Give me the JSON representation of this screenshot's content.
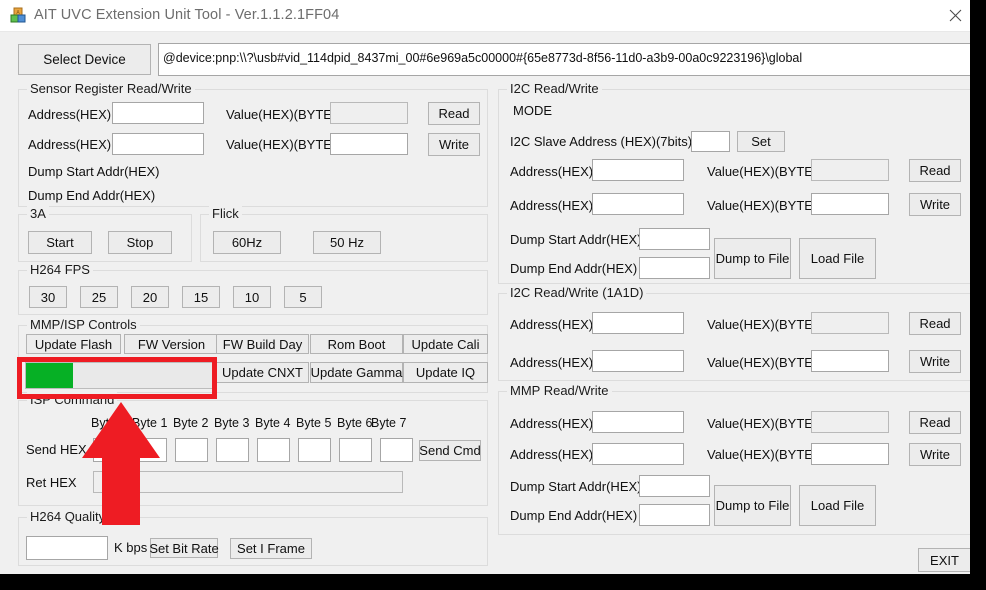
{
  "window": {
    "title": "AIT UVC Extension Unit Tool - Ver.1.1.2.1FF04",
    "icon": "blocks-icon",
    "close_icon": "close-icon",
    "accent_green": "#06b025",
    "annotation_red": "#ee1c23"
  },
  "device": {
    "select_button": "Select Device",
    "path_value": "@device:pnp:\\\\?\\usb#vid_114dpid_8437mi_00#6e969a5c00000#{65e8773d-8f56-11d0-a3b9-00a0c9223196}\\global",
    "path_placeholder": ""
  },
  "sensor": {
    "title": "Sensor Register Read/Write",
    "addr_label_1": "Address(HEX)",
    "addr_value_1": "",
    "value_label_1": "Value(HEX)(BYTE)",
    "value_value_1": "",
    "read_button": "Read",
    "addr_label_2": "Address(HEX)",
    "addr_value_2": "",
    "value_label_2": "Value(HEX)(BYTE)",
    "value_value_2": "",
    "write_button": "Write",
    "dump_start_label": "Dump Start Addr(HEX)",
    "dump_end_label": "Dump End Addr(HEX)"
  },
  "threea": {
    "title": "3A",
    "start_button": "Start",
    "stop_button": "Stop"
  },
  "flick": {
    "title": "Flick",
    "hz60_button": "60Hz",
    "hz50_button": "50 Hz"
  },
  "h264fps": {
    "title": "H264 FPS",
    "options": [
      "30",
      "25",
      "20",
      "15",
      "10",
      "5"
    ]
  },
  "mmpisp": {
    "title": "MMP/ISP Controls",
    "row1": [
      "Update Flash",
      "FW Version",
      "FW Build Day",
      "Rom Boot",
      "Update Cali"
    ],
    "row2": [
      "Update CNXT",
      "Update Gamma",
      "Update IQ"
    ],
    "progress_percent": 25
  },
  "isp_command": {
    "title": "ISP Command",
    "byte_headers": [
      "Byte 0",
      "Byte 1",
      "Byte 2",
      "Byte 3",
      "Byte 4",
      "Byte 5",
      "Byte 6",
      "Byte 7"
    ],
    "send_label": "Send  HEX",
    "send_values": [
      "",
      "",
      "",
      "",
      "",
      "",
      "",
      ""
    ],
    "send_button": "Send Cmd",
    "ret_label": "Ret  HEX",
    "ret_value": ""
  },
  "h264quality": {
    "title": "H264 Quality",
    "bitrate_value": "",
    "unit_label": "K bps",
    "set_bit_rate_button": "Set Bit Rate",
    "set_i_frame_button": "Set I Frame"
  },
  "i2c": {
    "title": "I2C Read/Write",
    "mode_label": "MODE",
    "slave_label": "I2C Slave Address (HEX)(7bits)",
    "slave_value": "",
    "set_button": "Set",
    "addr_label_1": "Address(HEX)",
    "addr_value_1": "",
    "value_label_1": "Value(HEX)(BYTE)",
    "value_value_1": "",
    "read_button": "Read",
    "addr_label_2": "Address(HEX)",
    "addr_value_2": "",
    "value_label_2": "Value(HEX)(BYTE)",
    "value_value_2": "",
    "write_button": "Write",
    "dump_start_label": "Dump Start Addr(HEX)",
    "dump_start_value": "",
    "dump_end_label": "Dump End Addr(HEX)",
    "dump_end_value": "",
    "dump_to_file_button": "Dump to File",
    "load_file_button": "Load File"
  },
  "i2c_1a1d": {
    "title": "I2C Read/Write (1A1D)",
    "addr_label_1": "Address(HEX)",
    "addr_value_1": "",
    "value_label_1": "Value(HEX)(BYTE)",
    "value_value_1": "",
    "read_button": "Read",
    "addr_label_2": "Address(HEX)",
    "addr_value_2": "",
    "value_label_2": "Value(HEX)(BYTE)",
    "value_value_2": "",
    "write_button": "Write"
  },
  "mmp": {
    "title": "MMP Read/Write",
    "addr_label_1": "Address(HEX)",
    "addr_value_1": "",
    "value_label_1": "Value(HEX)(BYTE)",
    "value_value_1": "",
    "read_button": "Read",
    "addr_label_2": "Address(HEX)",
    "addr_value_2": "",
    "value_label_2": "Value(HEX)(BYTE)",
    "value_value_2": "",
    "write_button": "Write",
    "dump_start_label": "Dump Start Addr(HEX)",
    "dump_start_value": "",
    "dump_end_label": "Dump End Addr(HEX)",
    "dump_end_value": "",
    "dump_to_file_button": "Dump to File",
    "load_file_button": "Load File"
  },
  "footer": {
    "exit_button": "EXIT"
  }
}
